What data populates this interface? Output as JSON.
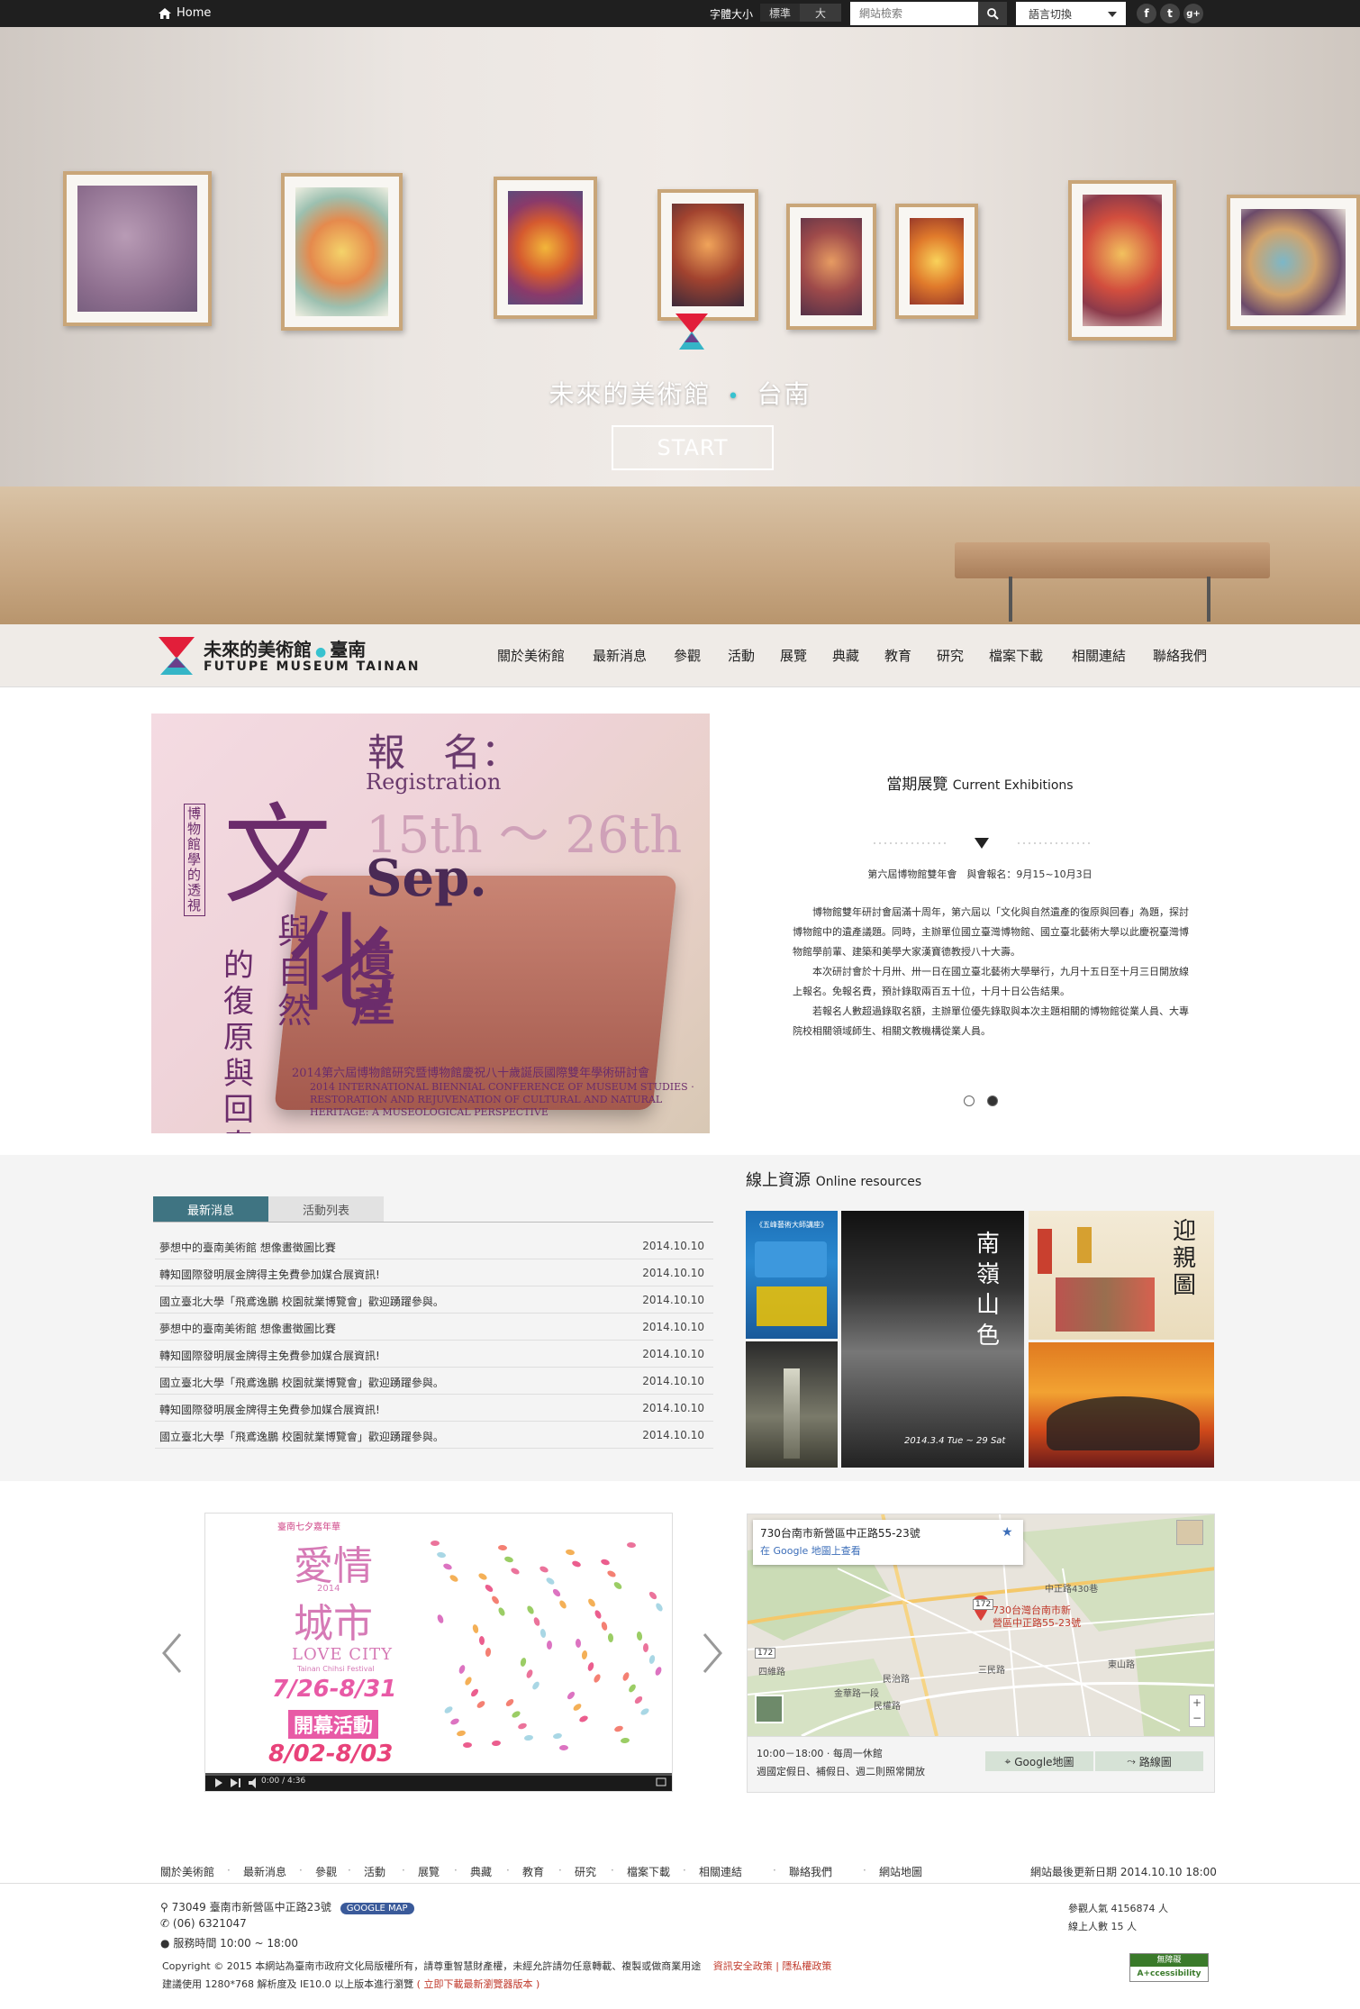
{
  "topbar": {
    "home": "Home",
    "font_size_label": "字體大小",
    "font_normal": "標準",
    "font_large": "大",
    "search_placeholder": "網站檢索",
    "language": "語言切換",
    "social": [
      "f",
      "t",
      "g+"
    ]
  },
  "hero": {
    "title_left": "未來的美術館",
    "title_sep": "•",
    "title_right": "台南",
    "start": "START"
  },
  "brand": {
    "name_cn": "未來的美術館",
    "name_city": "臺南",
    "name_en": "FUTUPE MUSEUM TAINAN"
  },
  "nav": [
    "關於美術館",
    "最新消息",
    "參觀",
    "活動",
    "展覽",
    "典藏",
    "教育",
    "研究",
    "檔案下載",
    "相關連結",
    "聯絡我們"
  ],
  "feature_poster": {
    "reg_cn": "報　名：",
    "reg_en": "Registration",
    "date": "15th ～ 26th",
    "month": "Sep.",
    "big_a": "文",
    "big_b": "化",
    "vertical_small": "博物館學的透視",
    "vertical_1": "與自然",
    "vertical_2": "的復原與回春",
    "vertical_3": "遺產",
    "bottom_cn": "2014第六屆博物館研究暨博物館慶祝八十歲誕辰國際雙年學術研討會",
    "bottom_en": "2014 INTERNATIONAL BIENNIAL CONFERENCE OF MUSEUM STUDIES · RESTORATION AND REJUVENATION OF CULTURAL AND NATURAL HERITAGE: A MUSEOLOGICAL PERSPECTIVE"
  },
  "exhibition": {
    "heading_cn": "當期展覽",
    "heading_en": "Current Exhibitions",
    "subtitle": "第六屆博物館雙年會　與會報名：9月15~10月3日",
    "paragraphs": [
      "博物館雙年研討會屆滿十周年，第六屆以「文化與自然遺產的復原與回春」為題，探討博物館中的遺產議題。同時，主辦單位國立臺灣博物館、國立臺北藝術大學以此慶祝臺灣博物館學前輩、建築和美學大家漢寶德教授八十大壽。",
      "本次研討會於十月卅、卅一日在國立臺北藝術大學舉行，九月十五日至十月三日開放線上報名。免報名費，預計錄取兩百五十位，十月十日公告結果。",
      "若報名人數超過錄取名額，主辦單位優先錄取與本次主題相關的博物館從業人員、大專院校相關領域師生、相關文教機構從業人員。"
    ]
  },
  "news": {
    "tab_active": "最新消息",
    "tab_inactive": "活動列表",
    "items": [
      {
        "title": "夢想中的臺南美術館 想像畫徵圖比賽",
        "date": "2014.10.10"
      },
      {
        "title": "轉知國際發明展金牌得主免費參加媒合展資訊!",
        "date": "2014.10.10"
      },
      {
        "title": "國立臺北大學「飛鳶逸鵬 校園就業博覽會」歡迎踴躍參與。",
        "date": "2014.10.10"
      },
      {
        "title": "夢想中的臺南美術館 想像畫徵圖比賽",
        "date": "2014.10.10"
      },
      {
        "title": "轉知國際發明展金牌得主免費參加媒合展資訊!",
        "date": "2014.10.10"
      },
      {
        "title": "國立臺北大學「飛鳶逸鵬 校園就業博覽會」歡迎踴躍參與。",
        "date": "2014.10.10"
      },
      {
        "title": "轉知國際發明展金牌得主免費參加媒合展資訊!",
        "date": "2014.10.10"
      },
      {
        "title": "國立臺北大學「飛鳶逸鵬 校園就業博覽會」歡迎踴躍參與。",
        "date": "2014.10.10"
      }
    ]
  },
  "resources": {
    "heading_cn": "線上資源",
    "heading_en": "Online resources",
    "res3_text": "迎親圖",
    "res2_text": "南嶺山色",
    "res2_date": "2014.3.4 Tue ~ 29 Sat",
    "res1_title": "《五峰藝術大師講座》"
  },
  "video_poster": {
    "top": "臺南七夕嘉年華",
    "cn_1": "愛情",
    "year": "2014",
    "cn_2": "城市",
    "en": "LOVE CITY",
    "en_sub": "Tainan Chihsi Festival",
    "dates": "7/26-8/31",
    "event": "開幕活動",
    "event_dates": "8/02-8/03",
    "time": "0:00 / 4:36"
  },
  "map": {
    "address": "730台南市新營區中正路55-23號",
    "link": "在 Google 地圖上查看",
    "pin_label_1": "730台灣台南市新",
    "pin_label_2": "營區中正路55-23號",
    "roads": [
      "中正路430巷",
      "172",
      "三民路",
      "四維路",
      "民治路",
      "金華路一段",
      "東山路",
      "民權路",
      "172"
    ],
    "hours": "10:00－18:00 · 每周一休館",
    "holiday": "週國定假日、補假日、週二則照常開放",
    "btn_map": "Google地圖",
    "btn_route": "路線圖"
  },
  "footer": {
    "nav": [
      "關於美術館",
      "最新消息",
      "參觀",
      "活動",
      "展覽",
      "典藏",
      "教育",
      "研究",
      "檔案下載",
      "相關連結",
      "聯絡我們",
      "網站地圖"
    ],
    "updated": "網站最後更新日期 2014.10.10 18:00",
    "address": "73049 臺南市新營區中正路23號",
    "map_badge": "GOOGLE MAP",
    "phone": "(06) 6321047",
    "hours": "服務時間 10:00 ~ 18:00",
    "copyright": "Copyright © 2015  本網站為臺南市政府文化局版權所有，請尊重智慧財產權，未經允許請勿任意轉載、複製或做商業用途",
    "policy": "資訊安全政策 | 隱私權政策",
    "browser_note": "建議使用 1280*768 解析度及 IE10.0 以上版本進行瀏覽",
    "browser_link": "( 立即下載最新瀏覽器版本 )",
    "visits": "參觀人氣  4156874  人",
    "online": "線上人數  15  人",
    "badge_top": "無障礙",
    "badge_bottom": "A+ccessibility"
  }
}
